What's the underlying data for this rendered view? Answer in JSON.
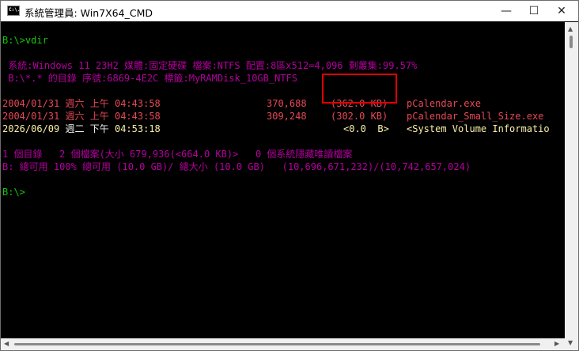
{
  "window": {
    "title": "系統管理員: Win7X64_CMD",
    "icon_label": "C:\\.",
    "controls": {
      "minimize": "—",
      "maximize": "☐",
      "close": "✕"
    }
  },
  "console": {
    "prompt1": "B:\\>vdir",
    "info1": " 系統:Windows 11 23H2 媒體:固定硬碟 檔案:NTFS 配置:8區x512=4,096 剩叢集:99.57%",
    "info2": " B:\\*.* 的目錄 序號:6869-4E2C 標籤:MyRAMDisk_10GB_NTFS",
    "rows": [
      {
        "date": "2004/01/31",
        "day": "週六",
        "ampm": "上午",
        "time": "04:43:58",
        "size": "370,688",
        "kb": "(362.0 KB)",
        "name": "pCalendar.exe"
      },
      {
        "date": "2004/01/31",
        "day": "週六",
        "ampm": "上午",
        "time": "04:43:58",
        "size": "309,248",
        "kb": "(302.0 KB)",
        "name": "pCalendar_Small_Size.exe"
      },
      {
        "date": "2026/06/09",
        "day": "週二",
        "ampm": "下午",
        "time": "04:53:18",
        "size": "",
        "kb": "<0.0  B>",
        "name": "<System Volume Informatio"
      }
    ],
    "summary1": "1 個目錄   2 個檔案(大小 679,936(<664.0 KB)>   0 個系統隱藏唯讀檔案",
    "summary2": "B: 總可用 100% 總可用 (10.0 GB)/ 總大小 (10.0 GB)   (10,696,671,232)/(10,742,657,024)",
    "prompt2": "B:\\>"
  }
}
